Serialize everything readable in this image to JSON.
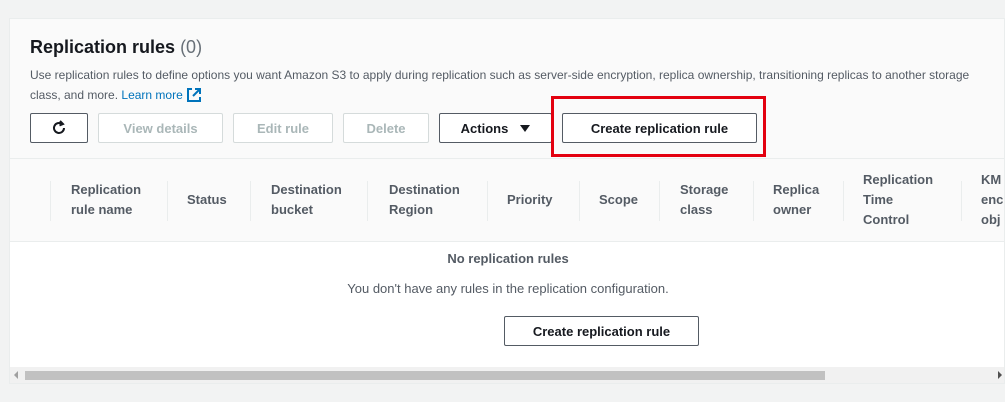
{
  "panel": {
    "title": "Replication rules",
    "count": "(0)",
    "description": "Use replication rules to define options you want Amazon S3 to apply during replication such as server-side encryption, replica ownership, transitioning replicas to another storage class, and more.",
    "learn_more": "Learn more"
  },
  "toolbar": {
    "view_details": "View details",
    "edit_rule": "Edit rule",
    "delete": "Delete",
    "actions": "Actions",
    "create_rule": "Create replication rule"
  },
  "table": {
    "columns": [
      [
        "Replication",
        "rule name"
      ],
      [
        "Status"
      ],
      [
        "Destination",
        "bucket"
      ],
      [
        "Destination",
        "Region"
      ],
      [
        "Priority"
      ],
      [
        "Scope"
      ],
      [
        "Storage",
        "class"
      ],
      [
        "Replica",
        "owner"
      ],
      [
        "Replication",
        "Time",
        "Control"
      ],
      [
        "KM",
        "enc",
        "obj"
      ]
    ]
  },
  "empty_state": {
    "title": "No replication rules",
    "message": "You don't have any rules in the replication configuration.",
    "button": "Create replication rule"
  },
  "colors": {
    "highlight": "#e3000f",
    "link": "#0073bb"
  },
  "icons": [
    "refresh-icon",
    "external-link-icon",
    "caret-down-icon"
  ]
}
